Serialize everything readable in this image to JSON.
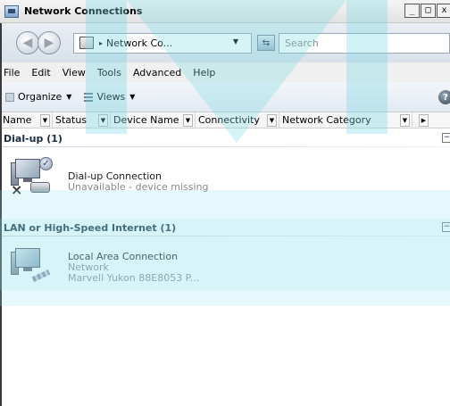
{
  "window": {
    "title": "Network Connections",
    "buttons": [
      "_",
      "□",
      "x"
    ]
  },
  "address": {
    "arrow": "▸",
    "path": "Network Co...",
    "search_placeholder": "Search"
  },
  "menu": [
    "File",
    "Edit",
    "View",
    "Tools",
    "Advanced",
    "Help"
  ],
  "toolbar": {
    "organize": "Organize",
    "views": "Views",
    "help": "?"
  },
  "columns": [
    "Name",
    "Status",
    "Device Name",
    "Connectivity",
    "Network Category"
  ],
  "groups": [
    {
      "header": "Dial-up (1)",
      "collapse": "⊟",
      "items": [
        {
          "name": "Dial-up Connection",
          "lines": [
            "Unavailable - device missing"
          ],
          "icon": "dialup-icon"
        }
      ]
    },
    {
      "header": "LAN or High-Speed Internet (1)",
      "collapse": "⊟",
      "items": [
        {
          "name": "Local Area Connection",
          "lines": [
            "Network",
            "Marvell Yukon 88E8053 P..."
          ],
          "icon": "lan-icon"
        }
      ]
    }
  ]
}
